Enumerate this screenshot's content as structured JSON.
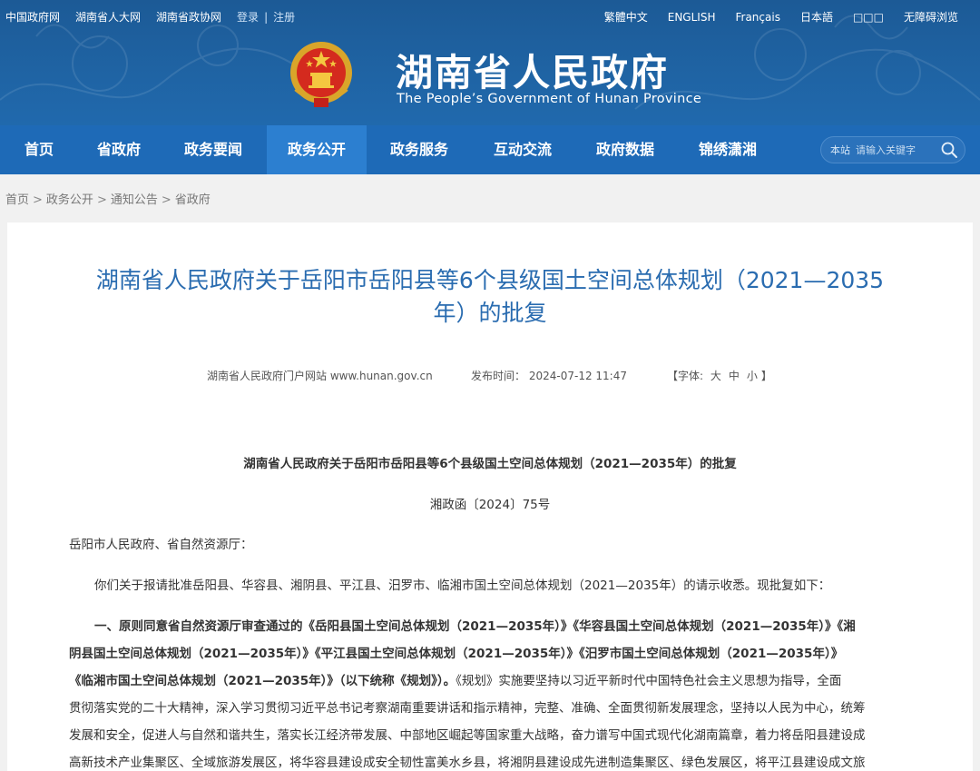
{
  "top_links": {
    "gov_site": "中国政府网",
    "npc_site": "湖南省人大网",
    "cppcc_site": "湖南省政协网",
    "login": "登录",
    "separator": "|",
    "register": "注册"
  },
  "lang_links": [
    "繁體中文",
    "ENGLISH",
    "Français",
    "日本語",
    "□□□",
    "无障碍浏览"
  ],
  "site": {
    "title": "湖南省人民政府",
    "subtitle": "The People’s Government of Hunan Province"
  },
  "nav": {
    "items": [
      "首页",
      "省政府",
      "政务要闻",
      "政务公开",
      "政务服务",
      "互动交流",
      "政府数据",
      "锦绣潇湘"
    ],
    "active_index": 3
  },
  "search": {
    "scope": "本站",
    "placeholder": "请输入关键字",
    "icon": "search-icon"
  },
  "breadcrumb": [
    "首页",
    "政务公开",
    "通知公告",
    "省政府"
  ],
  "breadcrumb_sep": ">",
  "article": {
    "title_line1": "湖南省人民政府关于岳阳市岳阳县等6个县级国土空间总体规划（2021—2035",
    "title_line2": "年）的批复",
    "source": "湖南省人民政府门户网站 www.hunan.gov.cn",
    "publish_label": "发布时间：",
    "publish_time": "2024-07-12 11:47",
    "font_prefix": "【字体:",
    "font_large": "大",
    "font_medium": "中",
    "font_small": "小",
    "font_suffix": "】",
    "doc_title": "湖南省人民政府关于岳阳市岳阳县等6个县级国土空间总体规划（2021—2035年）的批复",
    "doc_number": "湘政函〔2024〕75号",
    "addressee": "岳阳市人民政府、省自然资源厅：",
    "para1": "你们关于报请批准岳阳县、华容县、湘阴县、平江县、汨罗市、临湘市国土空间总体规划（2021—2035年）的请示收悉。现批复如下：",
    "para2_bold_l1": "一、原则同意省自然资源厅审查通过的《岳阳县国土空间总体规划（2021—2035年）》《华容县国土空间总体规划（2021—2035年）》《湘",
    "para2_bold_l2": "阴县国土空间总体规划（2021—2035年）》《平江县国土空间总体规划（2021—2035年）》《汨罗市国土空间总体规划（2021—2035年）》",
    "para2_bold_l3": "《临湘市国土空间总体规划（2021—2035年）》（以下统称《规划》）。",
    "para2_l3_rest": "《规划》实施要坚持以习近平新时代中国特色社会主义思想为指导，全面",
    "para2_l4": "贯彻落实党的二十大精神，深入学习贯彻习近平总书记考察湖南重要讲话和指示精神，完整、准确、全面贯彻新发展理念，坚持以人民为中心，统筹",
    "para2_l5": "发展和安全，促进人与自然和谐共生，落实长江经济带发展、中部地区崛起等国家重大战略，奋力谱写中国式现代化湖南篇章，着力将岳阳县建设成",
    "para2_l6": "高新技术产业集聚区、全域旅游发展区，将华容县建设成安全韧性富美水乡县，将湘阴县建设成先进制造集聚区、绿色发展区，将平江县建设成文旅"
  },
  "colors": {
    "header_blue": "#1f63a3",
    "nav_blue": "#1e6ab7",
    "nav_active": "#2c7fd0",
    "title_blue": "#2a6cb0"
  }
}
